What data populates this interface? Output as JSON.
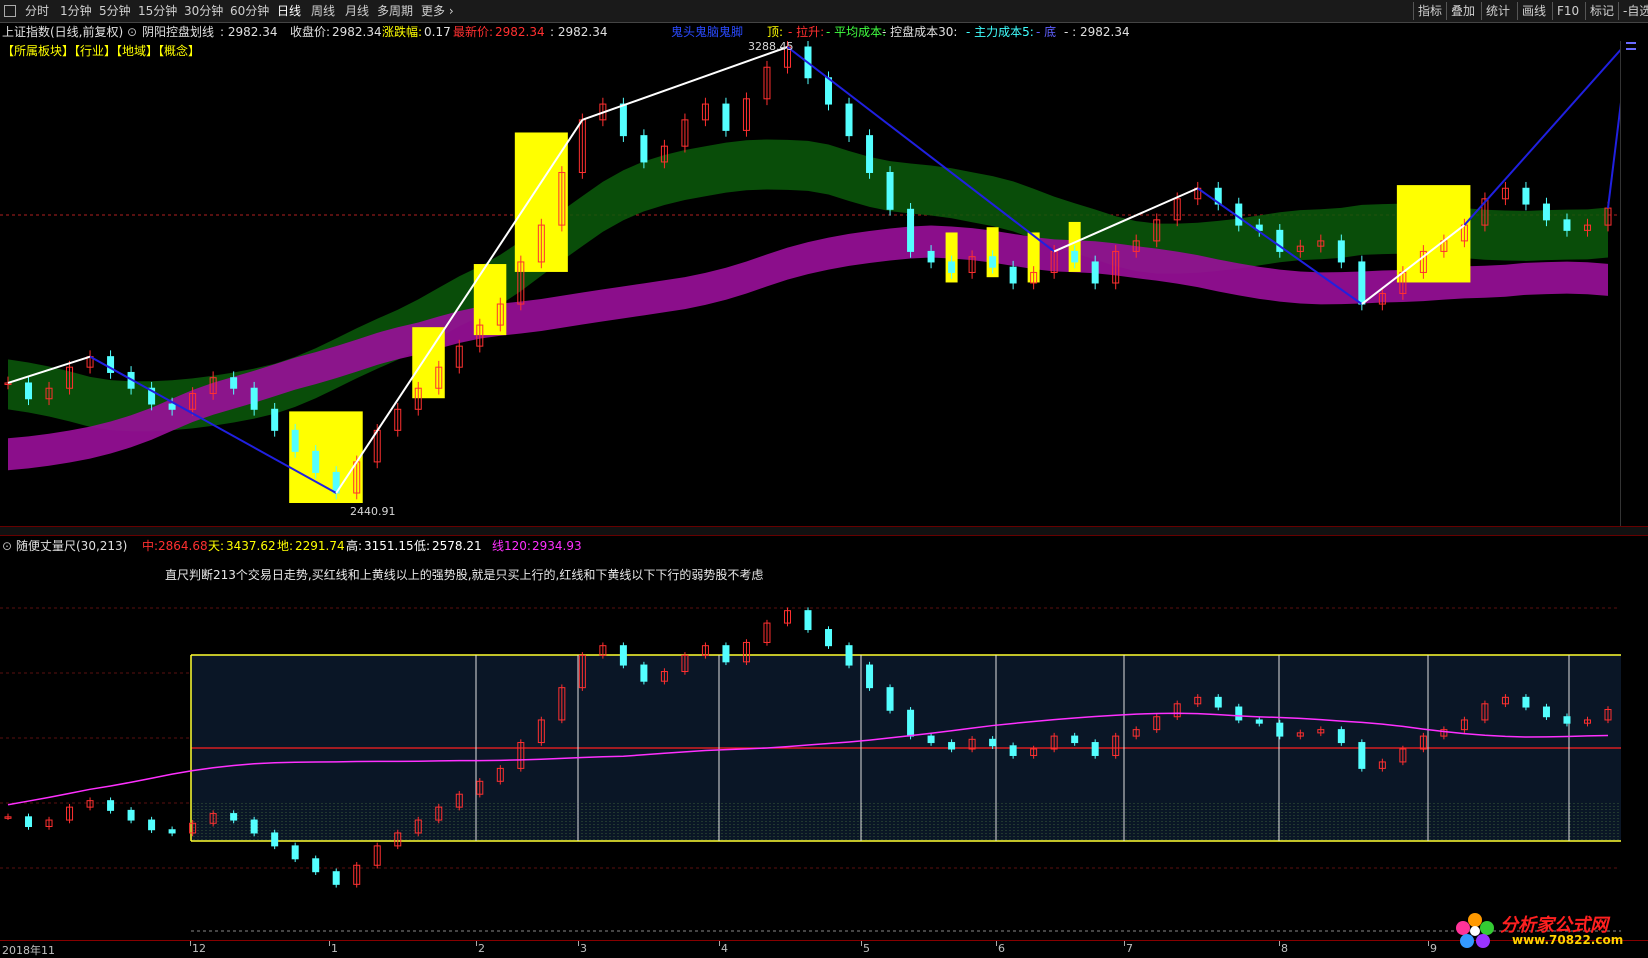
{
  "toolbar": {
    "periods": [
      "分时",
      "1分钟",
      "5分钟",
      "15分钟",
      "30分钟",
      "60分钟",
      "日线",
      "周线",
      "月线",
      "多周期",
      "更多"
    ],
    "active_period": "日线",
    "right_buttons": [
      "指标",
      "叠加",
      "统计",
      "画线",
      "F10",
      "标记",
      "-自选"
    ]
  },
  "info": {
    "index_name": "上证指数(日线,前复权)",
    "indicator_name": "阴阳控盘划线",
    "indicator_value": ": 2982.34",
    "close_label": "收盘价:",
    "close_value": "2982.34",
    "change_label": "涨跌幅:",
    "change_value": "0.17",
    "latest_label": "最新价:",
    "latest_value": "2982.34",
    "extra_value": ": 2982.34",
    "ghost_label": "鬼头鬼脑鬼脚",
    "top_label": "顶:",
    "lift_label": "- 拉升:",
    "avg_label": "- 平均成本:",
    "ctrl_label": "- 控盘成本30:",
    "main_label": "- 主力成本5:",
    "bottom_label": "- 底",
    "last_value": "- : 2982.34",
    "sectors": "【所属板块】【行业】【地域】【概念】"
  },
  "main": {
    "high_label": "3288.45",
    "low_label": "2440.91"
  },
  "sub": {
    "name": "随便丈量尺(30,213)",
    "zhong_label": "中:",
    "zhong_value": "2864.68",
    "tian_label": "天:",
    "tian_value": "3437.62",
    "di_label": "地:",
    "di_value": "2291.74",
    "gao_label": "高:",
    "gao_value": "3151.15",
    "low_label": "低:",
    "low_value": "2578.21",
    "line120_label": "线120:",
    "line120_value": "2934.93",
    "note": "直尺判断213个交易日走势,买红线和上黄线以上的强势股,就是只买上行的,红线和下黄线以下下行的弱势股不考虑"
  },
  "xaxis": {
    "labels": [
      "2018年11",
      "12",
      "1",
      "2",
      "3",
      "4",
      "5",
      "6",
      "7",
      "8",
      "9"
    ]
  },
  "watermark": {
    "name": "分析家公式网",
    "url": "www.70822.com"
  },
  "colors": {
    "up": "#ff3030",
    "down": "#54ffff",
    "ma_magenta": "#ff30ff",
    "band_green": "#0a5a0a",
    "band_purple": "#9a109a",
    "bar_yellow": "#ffff00",
    "zig_white": "#ffffff",
    "zig_blue": "#2020e0"
  },
  "chart_data": {
    "type": "candlestick",
    "price_range": [
      2440.91,
      3288.45
    ],
    "close_series": [
      2650,
      2620,
      2640,
      2680,
      2700,
      2670,
      2640,
      2610,
      2600,
      2630,
      2660,
      2640,
      2600,
      2560,
      2520,
      2480,
      2440.91,
      2500,
      2560,
      2600,
      2640,
      2680,
      2720,
      2760,
      2800,
      2880,
      2950,
      3050,
      3150,
      3180,
      3120,
      3070,
      3100,
      3150,
      3180,
      3130,
      3190,
      3250,
      3288.45,
      3230,
      3180,
      3120,
      3050,
      2980,
      2900,
      2880,
      2860,
      2890,
      2870,
      2840,
      2860,
      2900,
      2880,
      2840,
      2900,
      2920,
      2960,
      3000,
      3020,
      2990,
      2950,
      2940,
      2900,
      2910,
      2920,
      2880,
      2800,
      2820,
      2860,
      2900,
      2920,
      2950,
      3000,
      3020,
      2990,
      2960,
      2940,
      2950,
      2982.34
    ]
  }
}
